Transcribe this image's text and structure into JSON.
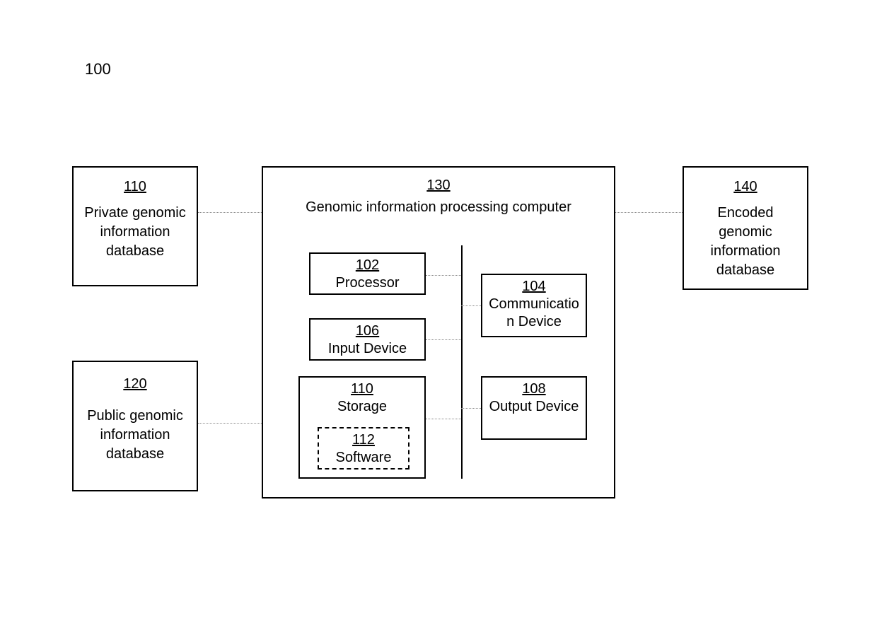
{
  "figure_number": "100",
  "blocks": {
    "private_db": {
      "ref": "110",
      "label": "Private genomic information database"
    },
    "public_db": {
      "ref": "120",
      "label": "Public genomic information database"
    },
    "computer": {
      "ref": "130",
      "label": "Genomic information processing computer"
    },
    "encoded_db": {
      "ref": "140",
      "label": "Encoded genomic information database"
    },
    "processor": {
      "ref": "102",
      "label": "Processor"
    },
    "comm": {
      "ref": "104",
      "label": "Communication Device"
    },
    "input": {
      "ref": "106",
      "label": "Input Device"
    },
    "output": {
      "ref": "108",
      "label": "Output Device"
    },
    "storage": {
      "ref": "110",
      "label": "Storage"
    },
    "software": {
      "ref": "112",
      "label": "Software"
    }
  }
}
